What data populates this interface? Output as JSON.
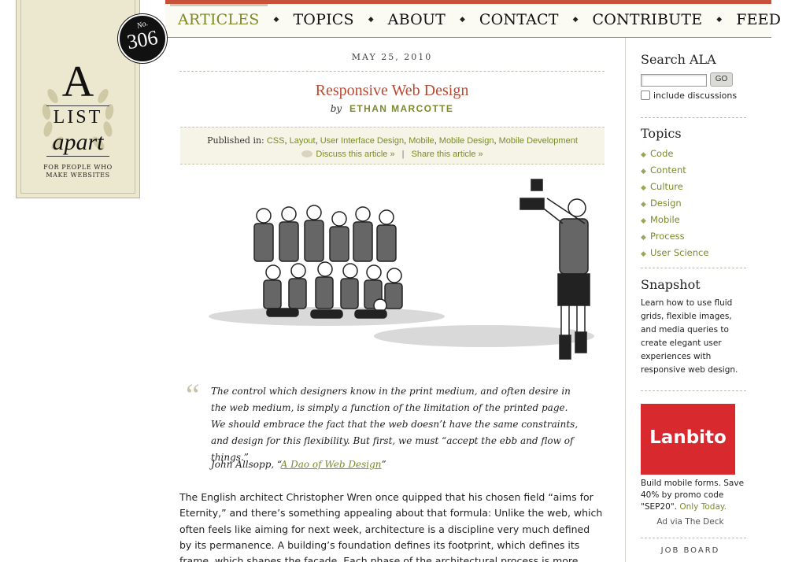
{
  "nav": {
    "items": [
      "ARTICLES",
      "TOPICS",
      "ABOUT",
      "CONTACT",
      "CONTRIBUTE",
      "FEED"
    ],
    "active": "ARTICLES"
  },
  "logo": {
    "letter": "A",
    "list": "LIST",
    "apart": "apart",
    "tagline_1": "FOR PEOPLE WHO",
    "tagline_2": "MAKE WEBSITES",
    "issue_prefix": "No.",
    "issue_number": "306"
  },
  "article": {
    "date": "MAY 25, 2010",
    "title": "Responsive Web Design",
    "by": "by",
    "author": "ETHAN MARCOTTE",
    "published_label": "Published in:",
    "categories": [
      "CSS",
      "Layout",
      "User Interface Design",
      "Mobile",
      "Mobile Design",
      "Mobile Development"
    ],
    "discuss": "Discuss this article »",
    "share": "Share this article »",
    "quote_mark": "“",
    "quote": "The control which designers know in the print medium, and often desire in the web medium, is simply a function of the limitation of the printed page. We should embrace the fact that the web doesn’t have the same constraints, and design for this flexibility. But first, we must “accept the ebb and flow of things.”",
    "cite_author": "John Allsopp, “",
    "cite_title": "A Dao of Web Design",
    "cite_close": "”",
    "body": "The English architect Christopher Wren once quipped that his chosen field “aims for Eternity,” and there’s something appealing about that formula: Unlike the web, which often feels like aiming for next week, architecture is a discipline very much defined by its permanence. A building’s foundation defines its footprint, which defines its frame, which shapes the facade. Each phase of the architectural process is more immutable, more unchanging than the last."
  },
  "sidebar": {
    "search_title": "Search ALA",
    "search_value": "",
    "go_label": "GO",
    "include_label": "include discussions",
    "topics_title": "Topics",
    "topics": [
      "Code",
      "Content",
      "Culture",
      "Design",
      "Mobile",
      "Process",
      "User Science"
    ],
    "snapshot_title": "Snapshot",
    "snapshot_text": "Learn how to use fluid grids, flexible images, and media queries to create elegant user experiences with responsive web design.",
    "ad_logo": "Lanbito",
    "ad_text": "Build mobile forms. Save 40% by promo code \"SEP20\".",
    "ad_today": "Only Today.",
    "ad_via": "Ad via The Deck",
    "job_board": "JOB BOARD"
  },
  "colors": {
    "accent_green": "#7a8b2a",
    "title_red": "#b84a32",
    "top_rule": "#c8513a",
    "ad_red": "#d8292e"
  }
}
